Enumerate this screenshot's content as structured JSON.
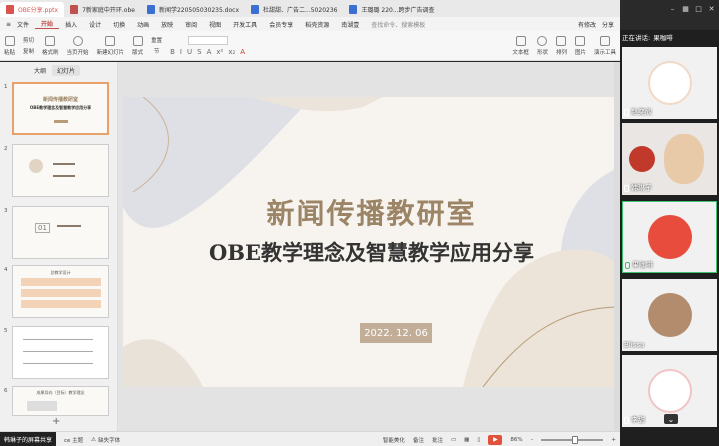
{
  "titlebar": {
    "tabs": [
      {
        "label": "OBE分享.pptx",
        "active": true,
        "color": "#d9534f"
      },
      {
        "label": "7新家庭中开环.obe",
        "active": false,
        "color": "#c0504d"
      },
      {
        "label": "新闻学220505030235.docx",
        "active": false,
        "color": "#3b6fd1"
      },
      {
        "label": "杜甜甜、广告二...5020236",
        "active": false,
        "color": "#3b6fd1"
      },
      {
        "label": "王璐璐 220...跨步广告调查",
        "active": false,
        "color": "#3b6fd1"
      }
    ],
    "window_controls": [
      "–",
      "□",
      "✕"
    ]
  },
  "ribbon_tabs": {
    "left": [
      "文件"
    ],
    "tabs": [
      "开始",
      "插入",
      "设计",
      "切换",
      "动画",
      "放映",
      "审阅",
      "视图",
      "开发工具",
      "会员专享",
      "稻壳资源",
      "南湖壹"
    ],
    "active_index": 0,
    "right": [
      "有修改",
      "分享"
    ],
    "search_placeholder": "查找命令、搜索模板"
  },
  "ribbon": {
    "buttons": [
      "粘贴",
      "剪切",
      "复制",
      "格式刷",
      "当页开始",
      "新建幻灯片",
      "版式",
      "重置",
      "节"
    ],
    "right_buttons": [
      "文本框",
      "形状",
      "排列",
      "图片",
      "演示工具"
    ],
    "format_glyphs": [
      "B",
      "I",
      "U",
      "S",
      "A",
      "x²",
      "x₂",
      "A"
    ]
  },
  "thumbs": {
    "tabs": [
      "大纲",
      "幻灯片"
    ],
    "active_tab": 1,
    "slides": [
      {
        "num": "1",
        "title": "新闻传播教研室",
        "sub": "OBE教学理念及智慧教学应用分享",
        "selected": true
      },
      {
        "num": "2",
        "selected": false
      },
      {
        "num": "3",
        "label": "01",
        "selected": false
      },
      {
        "num": "4",
        "label": "总教学设计",
        "selected": false
      },
      {
        "num": "5",
        "selected": false
      },
      {
        "num": "6",
        "label": "成果导向（目标）教学理念",
        "selected": false
      }
    ],
    "add_symbol": "+"
  },
  "slide": {
    "title": "新闻传播教研室",
    "subtitle": "OBE教学理念及智慧教学应用分享",
    "date": "2022. 12. 06"
  },
  "statusbar": {
    "share_label": "韩琳子的屏幕共享",
    "theme": "ce 主题",
    "missing_font": "缺失字体",
    "smart_beautify": "智能美化",
    "notes": "备注",
    "comments": "批注",
    "zoom": "86%",
    "zoom_fraction": 0.55
  },
  "meeting": {
    "speaking_label": "正在讲话:",
    "speaking_name": "果咖啡",
    "participants": [
      {
        "name": "赵奕欣",
        "avatar_color": "#f5e6d8"
      },
      {
        "name": "韩琳子",
        "avatar_color": "#c0392b"
      },
      {
        "name": "果咖啡",
        "avatar_color": "#e74c3c"
      },
      {
        "name": "Blissa",
        "avatar_color": "#b38b6d"
      },
      {
        "name": "李甜",
        "avatar_color": "#f7eaea"
      }
    ],
    "scroll_symbol": "⌄"
  }
}
